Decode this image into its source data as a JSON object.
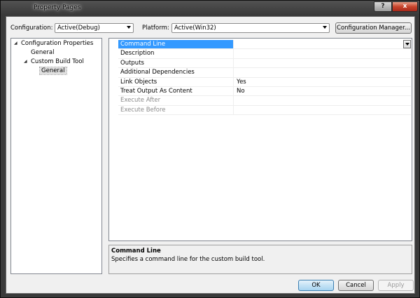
{
  "window": {
    "title": "Property Pages",
    "help_label": "?",
    "close_label": "x"
  },
  "toolbar": {
    "configuration_label": "Configuration:",
    "configuration_value": "Active(Debug)",
    "platform_label": "Platform:",
    "platform_value": "Active(Win32)",
    "config_manager_label": "Configuration Manager..."
  },
  "tree": {
    "items": [
      {
        "label": "Configuration Properties"
      },
      {
        "label": "General"
      },
      {
        "label": "Custom Build Tool"
      },
      {
        "label": "General"
      }
    ]
  },
  "grid": {
    "rows": [
      {
        "name": "Command Line",
        "value": ""
      },
      {
        "name": "Description",
        "value": ""
      },
      {
        "name": "Outputs",
        "value": ""
      },
      {
        "name": "Additional Dependencies",
        "value": ""
      },
      {
        "name": "Link Objects",
        "value": "Yes"
      },
      {
        "name": "Treat Output As Content",
        "value": "No"
      },
      {
        "name": "Execute After",
        "value": ""
      },
      {
        "name": "Execute Before",
        "value": ""
      }
    ]
  },
  "description": {
    "title": "Command Line",
    "text": "Specifies a command line for the custom build tool."
  },
  "buttons": {
    "ok": "OK",
    "cancel": "Cancel",
    "apply": "Apply"
  }
}
